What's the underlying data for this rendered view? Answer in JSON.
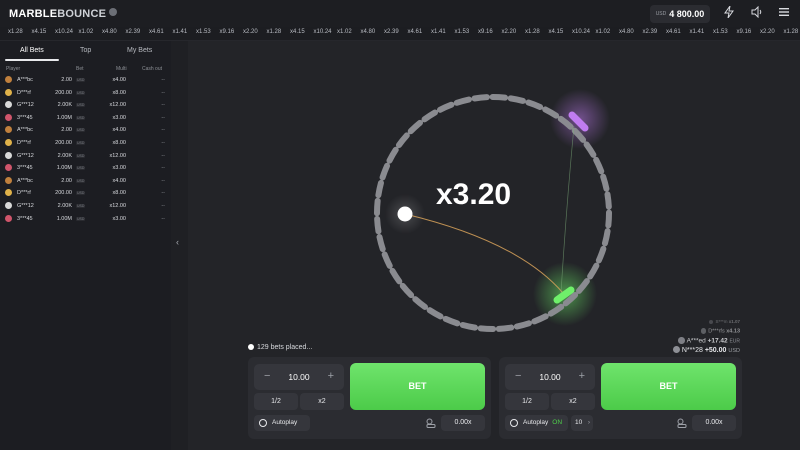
{
  "header": {
    "logo_main": "MARBLE",
    "logo_accent": "BOUNCE",
    "balance_currency": "USD",
    "balance_amount": "4 800.00",
    "icons": [
      "lightning-icon",
      "sound-icon",
      "menu-icon"
    ]
  },
  "ticker": [
    "x1.28",
    "x4.15",
    "x10.24",
    "x1.02",
    "x4.80",
    "x2.39",
    "x4.61",
    "x1.41",
    "x1.53",
    "x9.16",
    "x2.20",
    "x1.28",
    "x4.15",
    "x10.24",
    "x1.02",
    "x4.80",
    "x2.39",
    "x4.61",
    "x1.41",
    "x1.53",
    "x9.16",
    "x2.20",
    "x1.28",
    "x4.15",
    "x10.24",
    "x1.02",
    "x4.80",
    "x2.39",
    "x4.61",
    "x1.41",
    "x1.53",
    "x9.16",
    "x2.20",
    "x1.28"
  ],
  "left_panel": {
    "tabs": [
      "All Bets",
      "Top",
      "My Bets"
    ],
    "columns": [
      "Player",
      "Bet",
      "Multi",
      "Cash out"
    ],
    "rows": [
      {
        "player": "A***bc",
        "bet": "2.00",
        "cur": "USD",
        "mult": "x4.00",
        "cash": "--",
        "color": "#c0803d"
      },
      {
        "player": "D***rf",
        "bet": "200.00",
        "cur": "USD",
        "mult": "x8.00",
        "cash": "--",
        "color": "#e0b24a"
      },
      {
        "player": "G***12",
        "bet": "2.00K",
        "cur": "USD",
        "mult": "x12.00",
        "cash": "--",
        "color": "#d8d8d8"
      },
      {
        "player": "3***45",
        "bet": "1.00M",
        "cur": "USD",
        "mult": "x3.00",
        "cash": "--",
        "color": "#d0556b"
      },
      {
        "player": "A***bc",
        "bet": "2.00",
        "cur": "USD",
        "mult": "x4.00",
        "cash": "--",
        "color": "#c0803d"
      },
      {
        "player": "D***rf",
        "bet": "200.00",
        "cur": "USD",
        "mult": "x8.00",
        "cash": "--",
        "color": "#e0b24a"
      },
      {
        "player": "G***12",
        "bet": "2.00K",
        "cur": "USD",
        "mult": "x12.00",
        "cash": "--",
        "color": "#d8d8d8"
      },
      {
        "player": "3***45",
        "bet": "1.00M",
        "cur": "USD",
        "mult": "x3.00",
        "cash": "--",
        "color": "#d0556b"
      },
      {
        "player": "A***bc",
        "bet": "2.00",
        "cur": "USD",
        "mult": "x4.00",
        "cash": "--",
        "color": "#c0803d"
      },
      {
        "player": "D***rf",
        "bet": "200.00",
        "cur": "USD",
        "mult": "x8.00",
        "cash": "--",
        "color": "#e0b24a"
      },
      {
        "player": "G***12",
        "bet": "2.00K",
        "cur": "USD",
        "mult": "x12.00",
        "cash": "--",
        "color": "#d8d8d8"
      },
      {
        "player": "3***45",
        "bet": "1.00M",
        "cur": "USD",
        "mult": "x3.00",
        "cash": "--",
        "color": "#d0556b"
      }
    ]
  },
  "game": {
    "multiplier": "x3.20",
    "colors": {
      "marble": "#ffffff",
      "pad_purple": "#c07cf0",
      "pad_green": "#6ff06a",
      "ring": "#8a8b90"
    }
  },
  "live_wins": [
    {
      "player": "S***m",
      "mult": "x1.07",
      "amount": ""
    },
    {
      "player": "D***rfs",
      "mult": "x4.13",
      "amount": ""
    },
    {
      "player": "A***ed",
      "mult": "+17.42",
      "amount": "EUR"
    },
    {
      "player": "N***28",
      "mult": "+50.00",
      "amount": "USD"
    }
  ],
  "bets_placed": "129 bets placed...",
  "panels": [
    {
      "stake": "10.00",
      "half": "1/2",
      "double": "x2",
      "bet": "BET",
      "autoplay": "Autoplay",
      "autoplay_state": "",
      "rounds": "",
      "cashout": "0.00x"
    },
    {
      "stake": "10.00",
      "half": "1/2",
      "double": "x2",
      "bet": "BET",
      "autoplay": "Autoplay",
      "autoplay_state": "ON",
      "rounds": "10",
      "cashout": "0.00x"
    }
  ]
}
